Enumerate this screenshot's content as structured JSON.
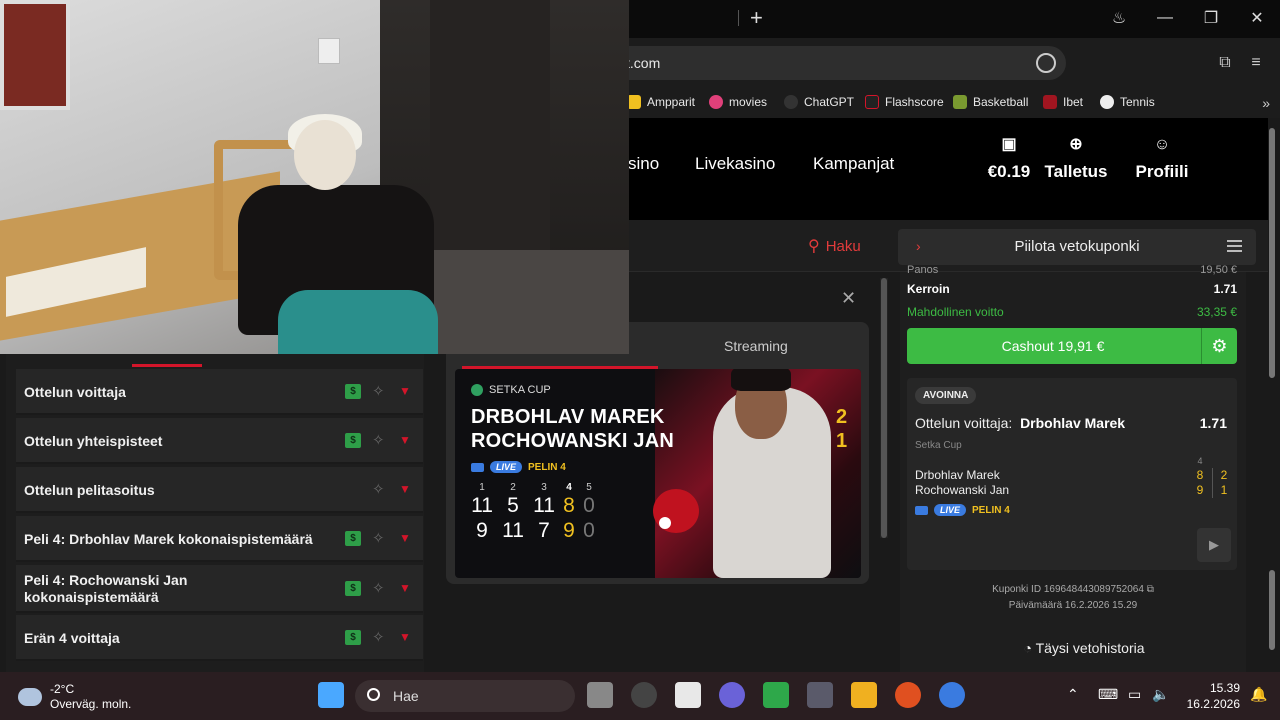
{
  "browser": {
    "address_text": "t.com",
    "bookmarks": [
      "Ampparit",
      "movies",
      "ChatGPT",
      "Flashscore",
      "Basketball",
      "Ibet",
      "Tennis"
    ]
  },
  "header": {
    "nav": [
      "sino",
      "Livekasino",
      "Kampanjat"
    ],
    "balance": "€0.19",
    "deposit": "Talletus",
    "profile": "Profiili"
  },
  "subbar": {
    "search_label": "Haku",
    "hide_slip": "Piilota vetokuponki"
  },
  "markets": [
    {
      "label": "Ottelun voittaja",
      "money": true
    },
    {
      "label": "Ottelun yhteispisteet",
      "money": true
    },
    {
      "label": "Ottelun pelitasoitus",
      "money": false
    },
    {
      "label": "Peli 4: Drbohlav Marek kokonaispistemäärä",
      "money": true
    },
    {
      "label": "Peli 4: Rochowanski Jan kokonaispistemäärä",
      "money": true
    },
    {
      "label": "Erän 4 voittaja",
      "money": true
    }
  ],
  "stream": {
    "tab_label": "Streaming",
    "cup": "SETKA CUP",
    "player1": "DRBOHLAV MAREK",
    "player2": "ROCHOWANSKI JAN",
    "sets1": "2",
    "sets2": "1",
    "live": "LIVE",
    "game": "PELIN 4",
    "set_headers": [
      "1",
      "2",
      "3",
      "4",
      "5"
    ],
    "scores1": [
      "11",
      "5",
      "11",
      "8",
      "0"
    ],
    "scores2": [
      "9",
      "11",
      "7",
      "9",
      "0"
    ]
  },
  "slip": {
    "partial_label": "Panos",
    "partial_value": "19,50 €",
    "odds_label": "Kerroin",
    "odds_value": "1.71",
    "win_label": "Mahdollinen voitto",
    "win_value": "33,35 €",
    "cashout": "Cashout 19,91 €",
    "status": "AVOINNA",
    "selection_prefix": "Ottelun voittaja:",
    "selection": "Drbohlav Marek",
    "selection_odds": "1.71",
    "cup": "Setka Cup",
    "current_set": "4",
    "p1": "Drbohlav Marek",
    "p2": "Rochowanski Jan",
    "p1_game": "8",
    "p1_sets": "2",
    "p2_game": "9",
    "p2_sets": "1",
    "live": "LIVE",
    "game": "PELIN 4",
    "coupon_id": "Kuponki ID 169648443089752064",
    "date": "Päivämäärä 16.2.2026 15.29",
    "history": "Täysi vetohistoria"
  },
  "taskbar": {
    "temp": "-2°C",
    "weather": "Overväg. moln.",
    "search": "Hae",
    "time": "15.39",
    "date": "16.2.2026"
  },
  "colors": {
    "accent_red": "#d3152a",
    "cashout_green": "#3dbb44",
    "score_yellow": "#f0c020",
    "win_green": "#3dbb44"
  }
}
